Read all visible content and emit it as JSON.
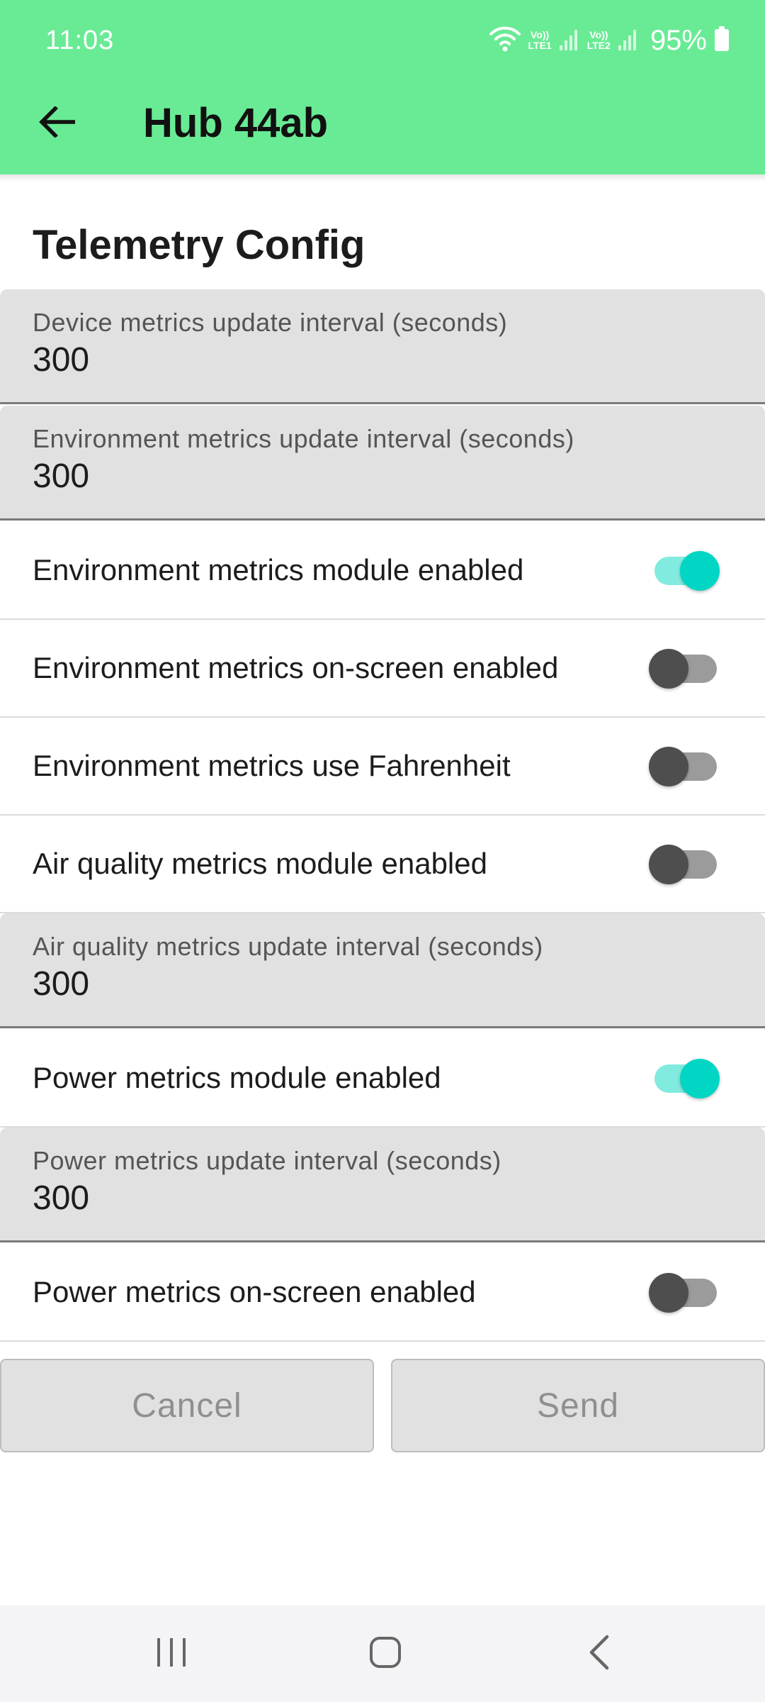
{
  "status_bar": {
    "time": "11:03",
    "battery": "95%",
    "sim1": "LTE1",
    "sim2": "LTE2"
  },
  "app_bar": {
    "title": "Hub 44ab"
  },
  "section": {
    "title": "Telemetry Config"
  },
  "fields": {
    "device_interval": {
      "label": "Device metrics update interval (seconds)",
      "value": "300"
    },
    "environment_interval": {
      "label": "Environment metrics update interval (seconds)",
      "value": "300"
    },
    "air_quality_interval": {
      "label": "Air quality metrics update interval (seconds)",
      "value": "300"
    },
    "power_interval": {
      "label": "Power metrics update interval (seconds)",
      "value": "300"
    }
  },
  "toggles": {
    "environment_module": {
      "label": "Environment metrics module enabled",
      "on": true
    },
    "environment_screen": {
      "label": "Environment metrics on-screen enabled",
      "on": false
    },
    "environment_fahrenheit": {
      "label": "Environment metrics use Fahrenheit",
      "on": false
    },
    "air_quality_module": {
      "label": "Air quality metrics module enabled",
      "on": false
    },
    "power_module": {
      "label": "Power metrics module enabled",
      "on": true
    },
    "power_screen": {
      "label": "Power metrics on-screen enabled",
      "on": false
    }
  },
  "buttons": {
    "cancel": "Cancel",
    "send": "Send"
  },
  "colors": {
    "app_bar": "#69eb95",
    "switch_on_thumb": "#00d6c3",
    "switch_on_track": "#82ebdf",
    "switch_off_thumb": "#4e4e4e",
    "switch_off_track": "#9b9b9b",
    "field_background": "#e1e1e1"
  },
  "icons": {
    "back": "arrow-left-icon",
    "wifi": "wifi-icon",
    "signal": "cell-signal-icon",
    "battery": "battery-icon",
    "recents": "recents-icon",
    "home": "home-icon",
    "nav_back": "chevron-left-icon"
  }
}
